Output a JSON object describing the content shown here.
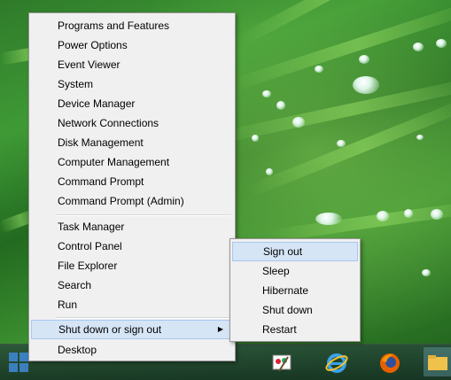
{
  "menu": {
    "group1": [
      {
        "label": "Programs and Features",
        "name": "menu-item-programs-and-features"
      },
      {
        "label": "Power Options",
        "name": "menu-item-power-options"
      },
      {
        "label": "Event Viewer",
        "name": "menu-item-event-viewer"
      },
      {
        "label": "System",
        "name": "menu-item-system"
      },
      {
        "label": "Device Manager",
        "name": "menu-item-device-manager"
      },
      {
        "label": "Network Connections",
        "name": "menu-item-network-connections"
      },
      {
        "label": "Disk Management",
        "name": "menu-item-disk-management"
      },
      {
        "label": "Computer Management",
        "name": "menu-item-computer-management"
      },
      {
        "label": "Command Prompt",
        "name": "menu-item-command-prompt"
      },
      {
        "label": "Command Prompt (Admin)",
        "name": "menu-item-command-prompt-admin"
      }
    ],
    "group2": [
      {
        "label": "Task Manager",
        "name": "menu-item-task-manager"
      },
      {
        "label": "Control Panel",
        "name": "menu-item-control-panel"
      },
      {
        "label": "File Explorer",
        "name": "menu-item-file-explorer"
      },
      {
        "label": "Search",
        "name": "menu-item-search"
      },
      {
        "label": "Run",
        "name": "menu-item-run"
      }
    ],
    "group3": [
      {
        "label": "Shut down or sign out",
        "name": "menu-item-shut-down-or-sign-out",
        "highlighted": true,
        "has_submenu": true
      },
      {
        "label": "Desktop",
        "name": "menu-item-desktop"
      }
    ],
    "submenu_arrow": "▶"
  },
  "submenu": {
    "items": [
      {
        "label": "Sign out",
        "name": "submenu-item-sign-out",
        "highlighted": true
      },
      {
        "label": "Sleep",
        "name": "submenu-item-sleep"
      },
      {
        "label": "Hibernate",
        "name": "submenu-item-hibernate"
      },
      {
        "label": "Shut down",
        "name": "submenu-item-shut-down"
      },
      {
        "label": "Restart",
        "name": "submenu-item-restart"
      }
    ]
  },
  "taskbar": {
    "icons": [
      "windows-start-icon",
      "search-icon",
      "file-explorer-icon",
      "paint-icon",
      "internet-explorer-icon",
      "firefox-icon",
      "folder-icon"
    ]
  },
  "colors": {
    "menu_bg": "#f0f0f0",
    "highlight_bg": "#d5e5f6",
    "highlight_border": "#a8c8ec"
  }
}
